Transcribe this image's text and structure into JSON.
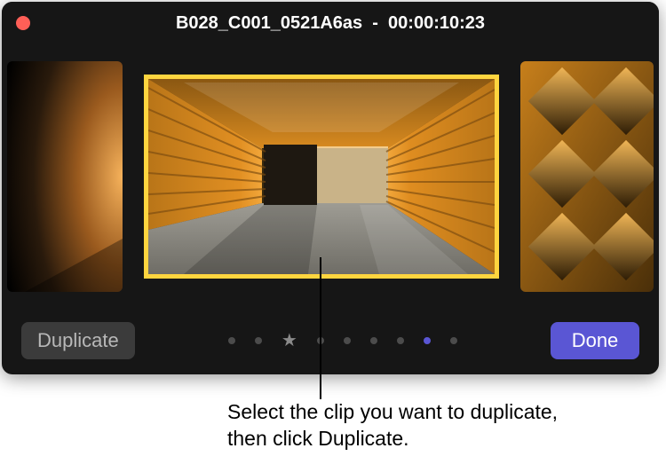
{
  "window": {
    "title": "B028_C001_0521A6as  -  00:00:10:23"
  },
  "buttons": {
    "duplicate": "Duplicate",
    "done": "Done"
  },
  "pager": {
    "count": 9,
    "favorite_index": 2,
    "active_index": 7
  },
  "caption": "Select the clip you want to duplicate, then click Duplicate.",
  "colors": {
    "accent": "#5a56d4",
    "selection": "#fed53f",
    "close": "#ff5f57"
  }
}
